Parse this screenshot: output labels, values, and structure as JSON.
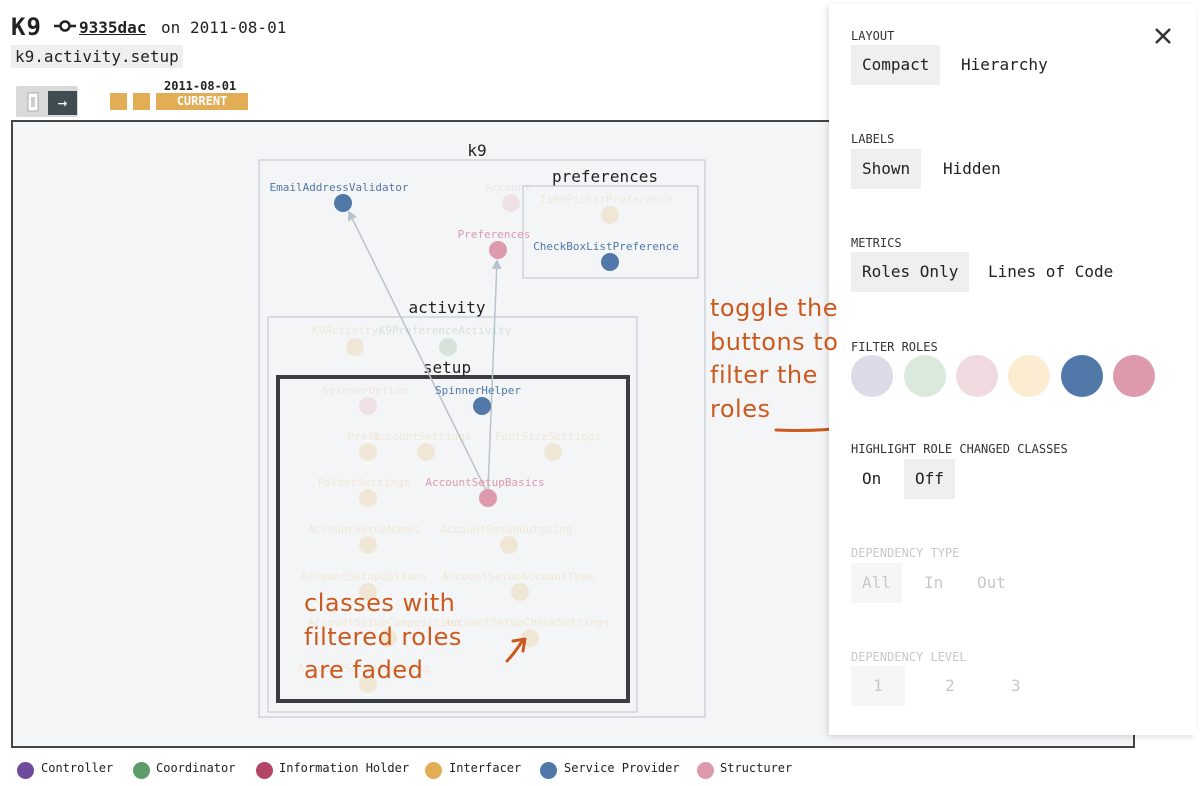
{
  "header": {
    "title": "K9",
    "commit_hash": "9335dac",
    "commit_on": "on",
    "commit_date": "2011-08-01",
    "module_path": "k9.activity.setup"
  },
  "timeline": {
    "date": "2011-08-01",
    "current_label": "CURRENT",
    "color": "#e3ad55"
  },
  "graph": {
    "containers": {
      "k9": "k9",
      "preferences": "preferences",
      "activity": "activity",
      "setup": "setup"
    },
    "nodes": [
      {
        "label": "EmailAddressValidator",
        "role": "service-provider",
        "faded": false
      },
      {
        "label": "Account",
        "role": "structurer",
        "faded": true
      },
      {
        "label": "Preferences",
        "role": "structurer",
        "faded": false
      },
      {
        "label": "TimePickerPreference",
        "role": "interfacer",
        "faded": true
      },
      {
        "label": "CheckBoxListPreference",
        "role": "service-provider",
        "faded": false
      },
      {
        "label": "K9Activity",
        "role": "interfacer",
        "faded": true
      },
      {
        "label": "K9PreferenceActivity",
        "role": "coordinator",
        "faded": true
      },
      {
        "label": "SpinnerOption",
        "role": "structurer",
        "faded": true
      },
      {
        "label": "SpinnerHelper",
        "role": "service-provider",
        "faded": false
      },
      {
        "label": "Prefs",
        "role": "interfacer",
        "faded": true
      },
      {
        "label": "AccountSettings",
        "role": "interfacer",
        "faded": true
      },
      {
        "label": "FontSizeSettings",
        "role": "interfacer",
        "faded": true
      },
      {
        "label": "FolderSettings",
        "role": "interfacer",
        "faded": true
      },
      {
        "label": "AccountSetupBasics",
        "role": "structurer",
        "faded": false
      },
      {
        "label": "AccountSetupNames",
        "role": "interfacer",
        "faded": true
      },
      {
        "label": "AccountSetupOutgoing",
        "role": "interfacer",
        "faded": true
      },
      {
        "label": "AccountSetupOptions",
        "role": "interfacer",
        "faded": true
      },
      {
        "label": "AccountSetupAccountType",
        "role": "interfacer",
        "faded": true
      },
      {
        "label": "AccountSetupComposition",
        "role": "interfacer",
        "faded": true
      },
      {
        "label": "AccountSetupCheckSettings",
        "role": "interfacer",
        "faded": true
      },
      {
        "label": "AccountSetupIncoming",
        "role": "interfacer",
        "faded": true
      }
    ],
    "edges": [
      {
        "from": "AccountSetupBasics",
        "to": "EmailAddressValidator"
      },
      {
        "from": "AccountSetupBasics",
        "to": "Preferences"
      }
    ]
  },
  "role_colors": {
    "controller": "#6e4c9a",
    "coordinator": "#5e9c6c",
    "information-holder": "#b54565",
    "interfacer": "#e3ad55",
    "service-provider": "#5078a8",
    "structurer": "#dd9aac"
  },
  "legend": [
    {
      "label": "Controller",
      "color": "#6e4c9a"
    },
    {
      "label": "Coordinator",
      "color": "#5e9c6c"
    },
    {
      "label": "Information Holder",
      "color": "#b54565"
    },
    {
      "label": "Interfacer",
      "color": "#e3ad55"
    },
    {
      "label": "Service Provider",
      "color": "#5078a8"
    },
    {
      "label": "Structurer",
      "color": "#dd9aac"
    }
  ],
  "panel": {
    "layout": {
      "title": "LAYOUT",
      "options": [
        "Compact",
        "Hierarchy"
      ],
      "selected": "Compact"
    },
    "labels": {
      "title": "LABELS",
      "options": [
        "Shown",
        "Hidden"
      ],
      "selected": "Shown"
    },
    "metrics": {
      "title": "METRICS",
      "options": [
        "Roles Only",
        "Lines of Code"
      ],
      "selected": "Roles Only"
    },
    "filter_roles": {
      "title": "FILTER ROLES",
      "buttons": [
        {
          "role": "controller",
          "color": "#ddd9e8",
          "active": false
        },
        {
          "role": "coordinator",
          "color": "#dbe9dd",
          "active": false
        },
        {
          "role": "information-holder",
          "color": "#f0d9df",
          "active": false
        },
        {
          "role": "interfacer",
          "color": "#fcecd2",
          "active": false
        },
        {
          "role": "service-provider",
          "color": "#5078a8",
          "active": true
        },
        {
          "role": "structurer",
          "color": "#dd9aac",
          "active": true
        }
      ]
    },
    "highlight": {
      "title": "HIGHLIGHT ROLE CHANGED CLASSES",
      "options": [
        "On",
        "Off"
      ],
      "selected": "Off"
    },
    "dependency_type": {
      "title": "DEPENDENCY TYPE",
      "options": [
        "All",
        "In",
        "Out"
      ],
      "selected": "All",
      "disabled": true
    },
    "dependency_level": {
      "title": "DEPENDENCY LEVEL",
      "options": [
        "1",
        "2",
        "3"
      ],
      "selected": "1",
      "disabled": true
    },
    "close_icon": "close-icon"
  },
  "annotations": {
    "toggle": [
      "toggle the",
      "buttons to",
      "filter the",
      "roles"
    ],
    "faded": [
      "classes with",
      "filtered roles",
      "are faded"
    ],
    "color": "#cc5a1f"
  }
}
